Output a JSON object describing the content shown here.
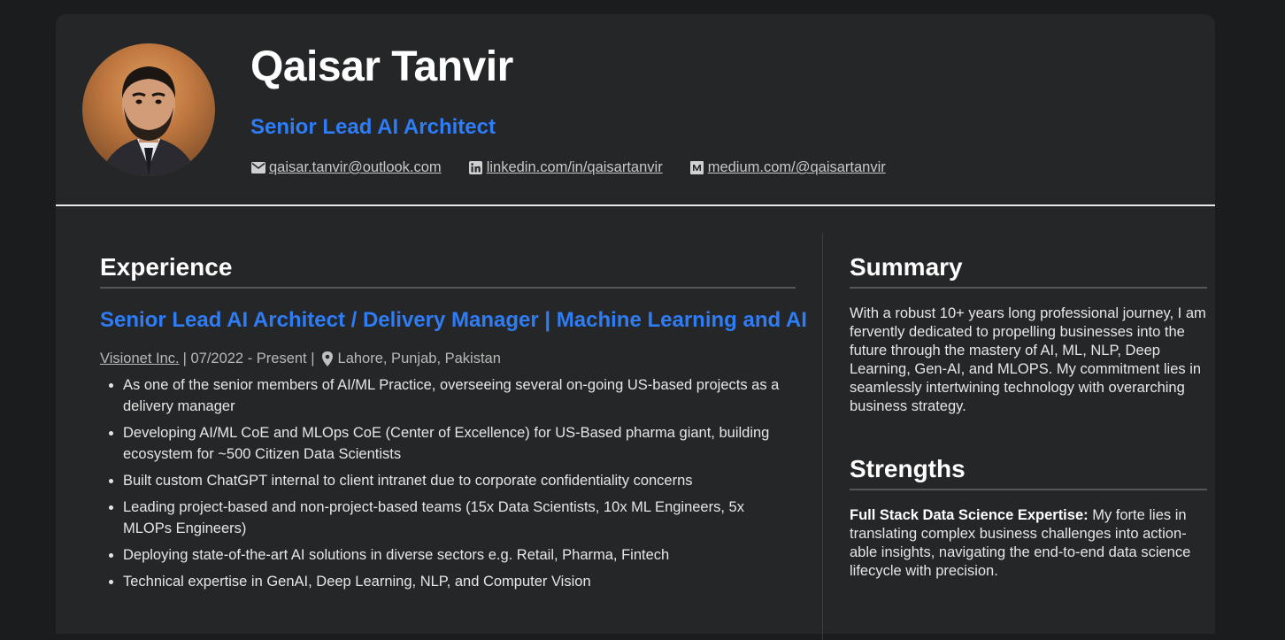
{
  "header": {
    "name": "Qaisar Tanvir",
    "role": "Senior Lead AI Architect",
    "contacts": [
      {
        "icon": "envelope-icon",
        "text": " qaisar.tanvir@outlook.com"
      },
      {
        "icon": "linkedin-icon",
        "text": " linkedin.com/in/qaisartanvir"
      },
      {
        "icon": "medium-icon",
        "text": " medium.com/@qaisartanvir"
      }
    ]
  },
  "experience": {
    "title": "Experience",
    "job": {
      "title": "Senior Lead AI Architect / Delivery Manager | Machine Learning and AI",
      "company": "Visionet Inc. ",
      "dates": "| 07/2022 - Present |",
      "location": "Lahore, Punjab, Pakistan",
      "bullets": [
        "As one of the senior members of AI/ML Practice, overseeing several on-going US-based projects as a delivery manager",
        "Developing AI/ML CoE and MLOps CoE (Center of Excellence) for US-Based pharma giant, building ecosystem for ~500 Citizen Data Scientists",
        "Built custom ChatGPT internal to client intranet due to corporate confidentiality concerns",
        "Leading project-based and non-project-based teams (15x Data Scientists, 10x ML Engineers, 5x MLOPs Engineers)",
        "Deploying state-of-the-art AI solutions in diverse sectors e.g. Retail, Pharma, Fintech",
        "Technical expertise in GenAI, Deep Learning, NLP, and Computer Vision"
      ]
    }
  },
  "summary": {
    "title": "Summary",
    "text": "With a robust 10+ years long professional journey, I am fervently dedicated to propelling businesses into the future through the mastery of AI, ML, NLP, Deep Learning, Gen-AI, and MLOPS. My commitment lies in seamlessly intertwining technology with overarch­ing business strategy."
  },
  "strengths": {
    "title": "Strengths",
    "item_label": "Full Stack Data Science Expertise:",
    "item_text": " My forte lies in translating complex business challenges into action­able insights, navigating the end-to-end data science lifecycle with precision."
  },
  "colors": {
    "accent": "#2e7cf6",
    "background": "#1b1c1d",
    "card": "#252628"
  }
}
